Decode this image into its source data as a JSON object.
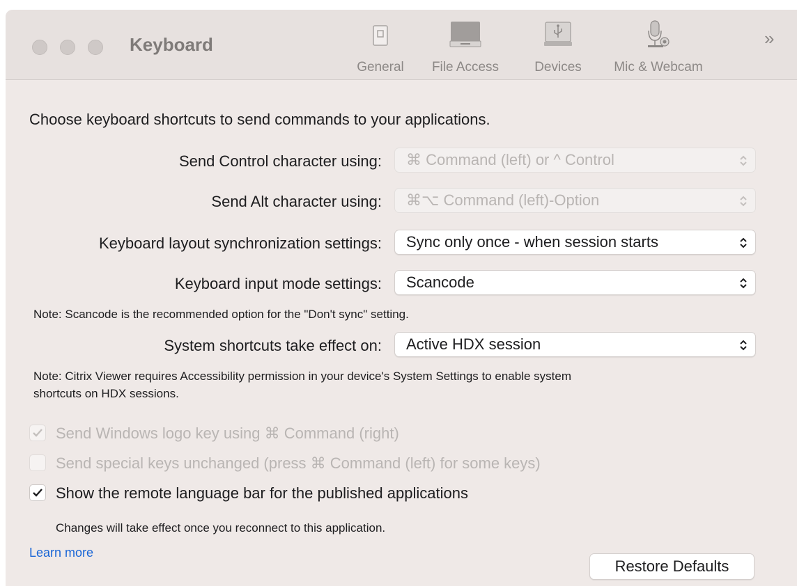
{
  "window": {
    "title": "Keyboard"
  },
  "toolbar": {
    "items": [
      {
        "label": "General",
        "icon": "general-icon"
      },
      {
        "label": "File Access",
        "icon": "drive-icon"
      },
      {
        "label": "Devices",
        "icon": "usb-icon"
      },
      {
        "label": "Mic & Webcam",
        "icon": "microphone-icon"
      }
    ],
    "overflow": "»"
  },
  "content": {
    "intro": "Choose keyboard shortcuts to send commands to your applications.",
    "settings": [
      {
        "label": "Send Control character using:",
        "value": "⌘ Command (left) or ^ Control",
        "enabled": false
      },
      {
        "label": "Send Alt character using:",
        "value": "⌘⌥ Command (left)-Option",
        "enabled": false
      },
      {
        "label": "Keyboard layout synchronization settings:",
        "value": "Sync only once - when session starts",
        "enabled": true
      },
      {
        "label": "Keyboard input mode settings:",
        "value": "Scancode",
        "enabled": true
      },
      {
        "label": "System shortcuts take effect on:",
        "value": "Active HDX session",
        "enabled": true
      }
    ],
    "note_scancode": "Note: Scancode is the recommended option for the \"Don't sync\" setting.",
    "note_accessibility_line1": "Note: Citrix Viewer requires Accessibility permission in your device's System Settings to enable system",
    "note_accessibility_line2": "shortcuts on HDX sessions.",
    "checkboxes": [
      {
        "label": "Send Windows logo key using ⌘ Command (right)",
        "checked": true,
        "enabled": false
      },
      {
        "label": "Send special keys unchanged (press ⌘ Command (left) for some keys)",
        "checked": false,
        "enabled": false
      },
      {
        "label": "Show the remote language bar for the published applications",
        "checked": true,
        "enabled": true
      }
    ],
    "reconnect_note": "Changes will take effect once you reconnect to this application.",
    "learn_more": "Learn more",
    "restore_defaults": "Restore Defaults"
  },
  "colors": {
    "link": "#1a66d6",
    "window_bg": "#efe9e7",
    "disabled_text": "#b9b5b3"
  }
}
